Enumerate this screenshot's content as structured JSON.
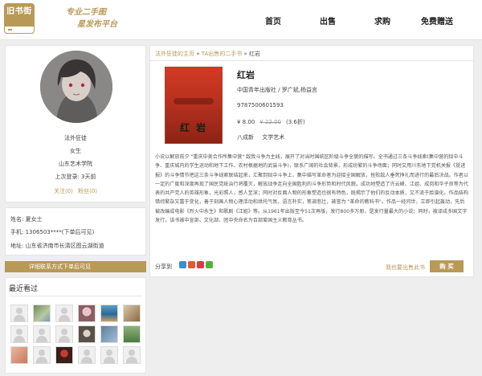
{
  "header": {
    "logo_text": "旧书街",
    "slogan_line1": "专业二手图",
    "slogan_line2": "星发布平台",
    "nav": [
      {
        "label": "首页"
      },
      {
        "label": "出售"
      },
      {
        "label": "求购"
      },
      {
        "label": "免费赠送"
      }
    ]
  },
  "profile": {
    "name": "法外狂徒",
    "gender": "女生",
    "school": "山东艺术学院",
    "last_login": "上次登录: 3天前",
    "follow_label": "关注(0)",
    "fans_label": "粉丝(0)"
  },
  "contact": {
    "name": "姓名: 夏女士",
    "phone": "手机: 1306503****(下单后可见)",
    "address": "地址: 山东省济南市长清区图云湖街道"
  },
  "view_contact_button": "详细联系方式下单后可见",
  "recent": {
    "title": "最近看过"
  },
  "breadcrumb": {
    "home": "法外狂徒的主页",
    "sep1": " » ",
    "section": "TA出售的二手书",
    "sep2": " » ",
    "current": "红岩"
  },
  "book": {
    "cover_title": "红 岩",
    "title": "红岩",
    "publisher_line": "中国青年出版社 / 罗广斌,杨益言",
    "isbn": "9787500601593",
    "price": "¥ 8.00",
    "original_price": "¥ 22.00",
    "discount": "(3.6折)",
    "condition": "八成新",
    "category": "文学艺术",
    "description": "小说以解放前夕 \"重庆中美合作所集中营\" 敌我斗争为主线，展开了对当时国统区阶级斗争全貌的描写。全书通过三条斗争线索(集中营的狱中斗争、重庆城内的学生运动和地下工作、农村根据地的武装斗争)，联系广阔的社会背景，形成纷繁的斗争场面；同时又用川东地下党机关报《挺进报》的斗争情节把这三条斗争线索联结起来，汇聚到狱中斗争上，集中描写革命者为迎接全国解放，挫败敌人垂死挣扎而进行的最后决战。作者以一定的广度和深度再现了国民党统治行将覆灭，解放战争走向全国胜利的斗争形势和时代风貌。成功地塑造了许云峰、江姐、成岗和华子良等为代表的共产党人的英雄形象，光彩照人，感人至深；同时对反面人物的形象塑造也很有特色，既揭示了他们的反动本质，又不流于脸谱化。作品结构错综繁杂又富于变化，善于刻画人物心理活动和烘托气氛，语言朴实，笔调悲壮，被誉为 \"革命的教科书\"。作品一经问世，立即引起轰动，先后被改编成电影《烈火中永生》和歌剧《江姐》等。从1961年出版至今51次再版，发行800多万册，是发行量最大的小说；同时，被译成多国文字发行，该书被中宣部、文化部、团中央命名为百部爱国主义教育丛书。",
    "share_label": "分享到",
    "sell_label": "我也要出售此书",
    "buy_button": "购  买"
  },
  "colors": {
    "accent": "#b89a57",
    "cover": "#c8361f"
  }
}
